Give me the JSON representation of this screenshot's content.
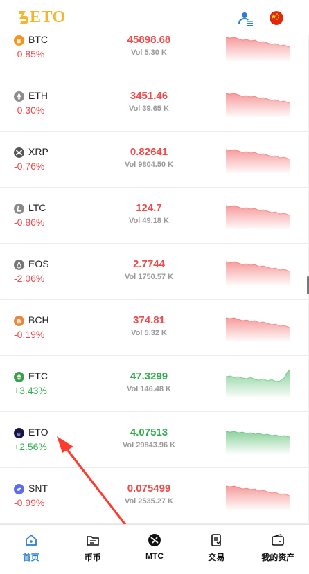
{
  "header": {
    "logo_text": "ETO",
    "user_icon": "user-list-icon",
    "language_icon": "china-flag-icon"
  },
  "colors": {
    "up": "#2fad4e",
    "down": "#f04a4a",
    "brand": "#f5b52c",
    "nav_active": "#2a7fcf"
  },
  "markets": [
    {
      "symbol": "BTC",
      "change": "-0.85%",
      "price": "45898.68",
      "vol": "Vol 5.30 K",
      "trend": "down",
      "icon": "bitcoin-icon"
    },
    {
      "symbol": "ETH",
      "change": "-0.30%",
      "price": "3451.46",
      "vol": "Vol 39.65 K",
      "trend": "down",
      "icon": "ethereum-icon"
    },
    {
      "symbol": "XRP",
      "change": "-0.76%",
      "price": "0.82641",
      "vol": "Vol 9804.50 K",
      "trend": "down",
      "icon": "ripple-icon"
    },
    {
      "symbol": "LTC",
      "change": "-0.86%",
      "price": "124.7",
      "vol": "Vol 49.18 K",
      "trend": "down",
      "icon": "litecoin-icon"
    },
    {
      "symbol": "EOS",
      "change": "-2.06%",
      "price": "2.7744",
      "vol": "Vol 1750.57 K",
      "trend": "down",
      "icon": "eos-icon"
    },
    {
      "symbol": "BCH",
      "change": "-0.19%",
      "price": "374.81",
      "vol": "Vol 5.32 K",
      "trend": "down",
      "icon": "bitcoin-cash-icon"
    },
    {
      "symbol": "ETC",
      "change": "+3.43%",
      "price": "47.3299",
      "vol": "Vol 146.48 K",
      "trend": "up",
      "icon": "ethereum-classic-icon"
    },
    {
      "symbol": "ETO",
      "change": "+2.56%",
      "price": "4.07513",
      "vol": "Vol 29843.96 K",
      "trend": "up",
      "icon": "eto-coin-icon"
    },
    {
      "symbol": "SNT",
      "change": "-0.99%",
      "price": "0.075499",
      "vol": "Vol 2535.27 K",
      "trend": "down",
      "icon": "status-icon"
    }
  ],
  "nav": [
    {
      "label": "首页",
      "icon": "home-icon",
      "active": true
    },
    {
      "label": "币币",
      "icon": "folder-icon",
      "active": false
    },
    {
      "label": "MTC",
      "icon": "mtc-icon",
      "active": false
    },
    {
      "label": "交易",
      "icon": "order-icon",
      "active": false
    },
    {
      "label": "我的资产",
      "icon": "wallet-icon",
      "active": false
    }
  ]
}
